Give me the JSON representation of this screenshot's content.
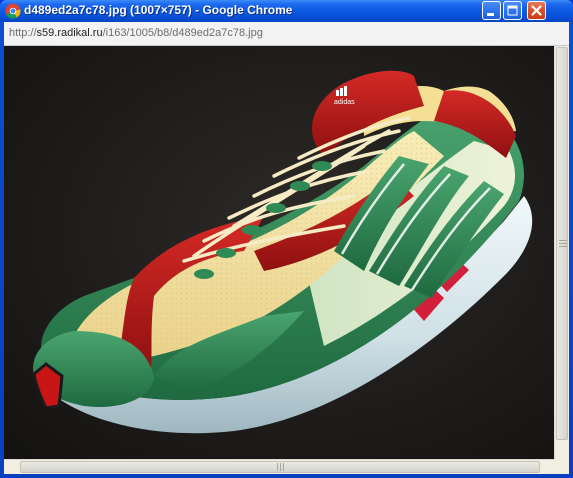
{
  "window": {
    "title": "d489ed2a7c78.jpg (1007×757) - Google Chrome"
  },
  "address_bar": {
    "url_prefix": "http://",
    "url_host": "s59.radikal.ru",
    "url_path": "/i163/1005/b8/d489ed2a7c78.jpg"
  },
  "image": {
    "brand_mark": "adidas"
  },
  "colors": {
    "titlebar": "#0a58e0",
    "shoe_red": "#b81a1a",
    "shoe_green": "#2f8a55",
    "shoe_cream": "#f3e3a0",
    "sole": "#dce9ec"
  }
}
